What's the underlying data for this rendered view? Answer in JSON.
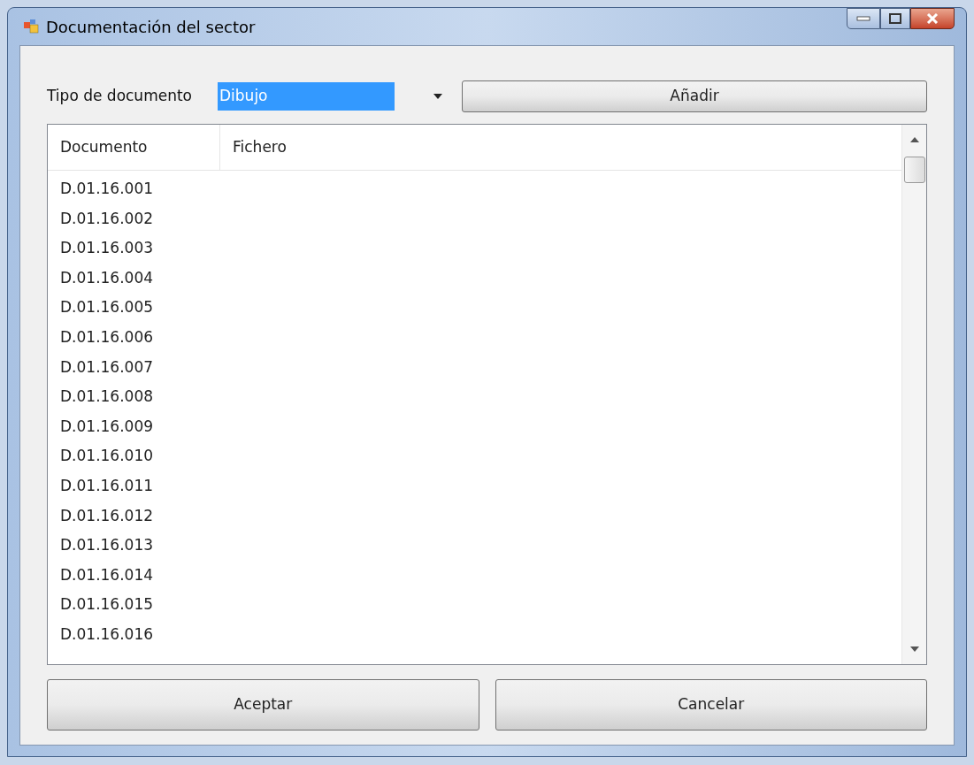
{
  "window": {
    "title": "Documentación del sector"
  },
  "document_type": {
    "label": "Tipo de documento",
    "value": "Dibujo",
    "selected": true
  },
  "add_button": "Añadir",
  "table": {
    "columns": [
      "Documento",
      "Fichero"
    ],
    "rows": [
      [
        "D.01.16.001"
      ],
      [
        "D.01.16.002"
      ],
      [
        "D.01.16.003"
      ],
      [
        "D.01.16.004"
      ],
      [
        "D.01.16.005"
      ],
      [
        "D.01.16.006"
      ],
      [
        "D.01.16.007"
      ],
      [
        "D.01.16.008"
      ],
      [
        "D.01.16.009"
      ],
      [
        "D.01.16.010"
      ],
      [
        "D.01.16.011"
      ],
      [
        "D.01.16.012"
      ],
      [
        "D.01.16.013"
      ],
      [
        "D.01.16.014"
      ],
      [
        "D.01.16.015"
      ],
      [
        "D.01.16.016"
      ]
    ]
  },
  "buttons": [
    "Aceptar",
    "Cancelar"
  ]
}
